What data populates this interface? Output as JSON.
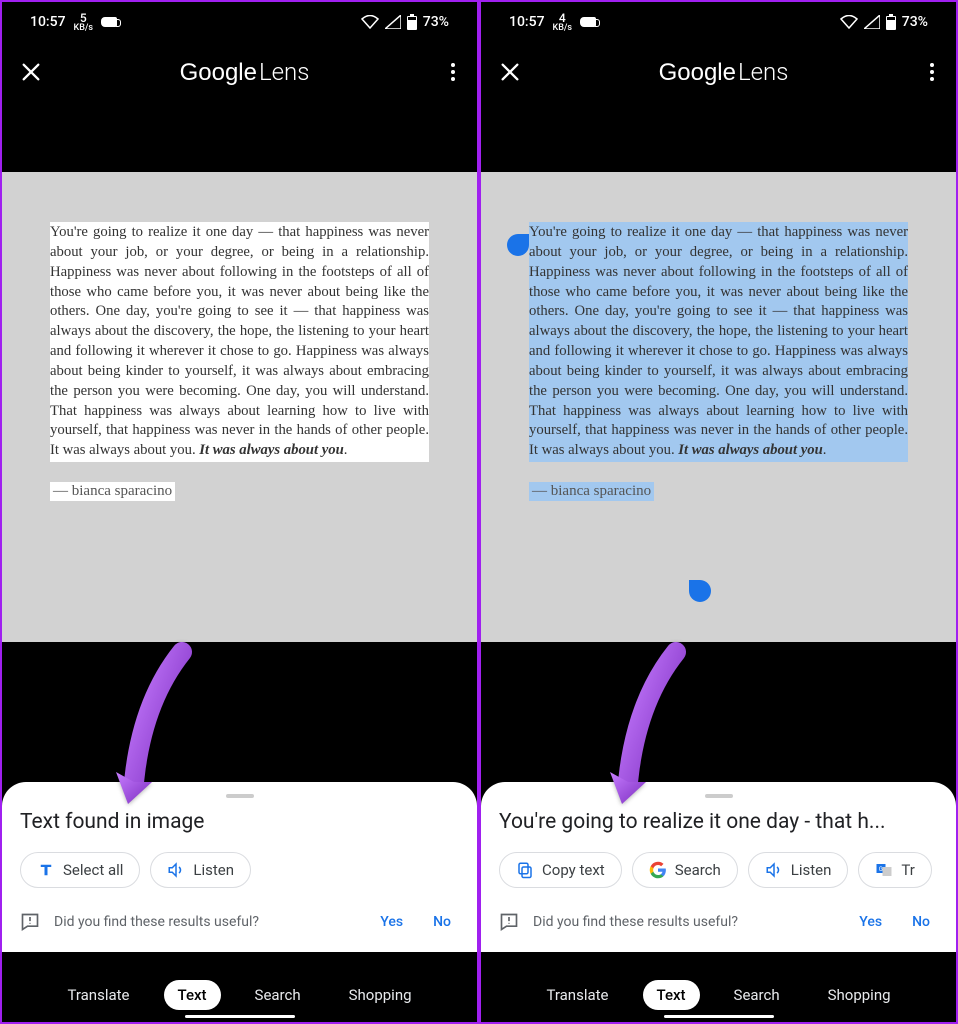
{
  "status": {
    "time": "10:57",
    "net_speed_left_num": "5",
    "net_speed_right_num": "4",
    "net_speed_unit": "KB/s",
    "battery": "73%"
  },
  "app": {
    "title_bold": "Google",
    "title_light": "Lens"
  },
  "quote": {
    "body": "You're going to realize it one day — that happiness was never about your job, or your degree, or being in a relationship. Happiness was never about following in the footsteps of all of those who came before you, it was never about being like the others. One day, you're going to see it — that happiness was always about the discovery, the hope, the listening to your heart and following it wherever it chose to go. Happiness was always about being kinder to yourself, it was always about embracing the person you were becoming. One day, you will understand. That happiness was always about learning how to live with yourself, that happiness was never in the hands of other people. It was always about you. ",
    "body_em": "It was always about you",
    "body_tail": ".",
    "author": "— bianca sparacino"
  },
  "sheet_left": {
    "title": "Text found in image",
    "chips": {
      "select_all": "Select all",
      "listen": "Listen"
    }
  },
  "sheet_right": {
    "title": "You're going to realize it one day - that h...",
    "chips": {
      "copy": "Copy text",
      "search": "Search",
      "listen": "Listen",
      "translate": "Translate"
    }
  },
  "feedback": {
    "question": "Did you find these results useful?",
    "yes": "Yes",
    "no": "No"
  },
  "tabs": {
    "translate": "Translate",
    "text": "Text",
    "search": "Search",
    "shopping": "Shopping"
  },
  "colors": {
    "accent": "#1a73e8",
    "annotation": "#a020f0",
    "selection": "#a2c8ef"
  }
}
